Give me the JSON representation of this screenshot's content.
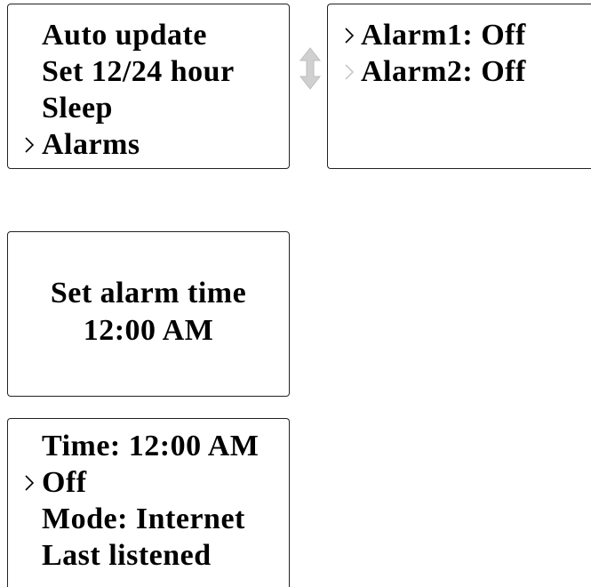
{
  "main_menu": {
    "items": [
      {
        "label": "Auto update",
        "cursor": ""
      },
      {
        "label": "Set 12/24 hour",
        "cursor": ""
      },
      {
        "label": "Sleep",
        "cursor": ""
      },
      {
        "label": "Alarms",
        "cursor": "active"
      }
    ]
  },
  "alarms_menu": {
    "items": [
      {
        "label": "Alarm1: Off",
        "cursor": "active"
      },
      {
        "label": "Alarm2: Off",
        "cursor": "faded"
      }
    ]
  },
  "set_alarm_time": {
    "title": "Set alarm time",
    "value": "12:00 AM"
  },
  "alarm_settings": {
    "items": [
      {
        "label": "Time: 12:00 AM",
        "cursor": ""
      },
      {
        "label": "Off",
        "cursor": "active"
      },
      {
        "label": "Mode: Internet",
        "cursor": ""
      },
      {
        "label": "Last listened",
        "cursor": ""
      }
    ]
  },
  "icons": {
    "cursor": "chevron-right-icon",
    "scroll": "up-down-arrow-icon"
  },
  "colors": {
    "text": "#000000",
    "border": "#222222",
    "faded_cursor": "#c8c8c8",
    "scroll_indicator": "#d0d0d0"
  }
}
